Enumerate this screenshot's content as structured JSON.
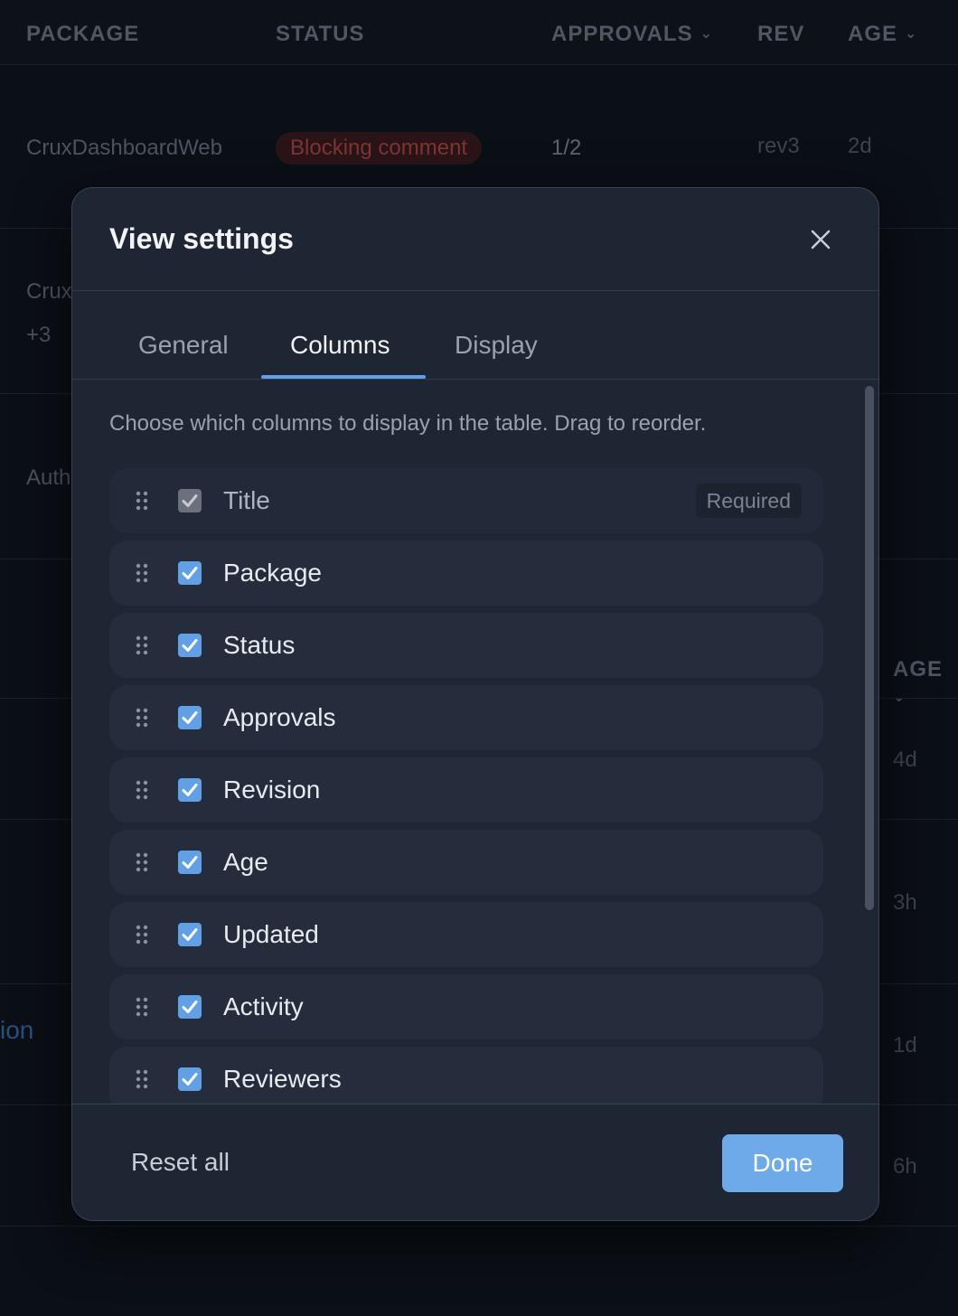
{
  "background_table": {
    "columns": {
      "package": "PACKAGE",
      "status": "STATUS",
      "approvals": "APPROVALS",
      "rev": "REV",
      "age": "AGE"
    },
    "rows": [
      {
        "package": "CruxDashboardWeb",
        "status": "Blocking comment",
        "approvals": "1/2",
        "rev": "rev3",
        "age": "2d"
      }
    ],
    "partial": {
      "crux": "Crux",
      "plus3": "+3",
      "auth": "Auth",
      "age_header": "AGE",
      "ion": "ion",
      "ages": [
        "4d",
        "3h",
        "1d",
        "6h"
      ]
    },
    "colors": {
      "status_blocking": "#7d3535",
      "link": "#2c4f7f"
    }
  },
  "modal": {
    "title": "View settings",
    "close_icon": "close-icon",
    "tabs": [
      {
        "label": "General",
        "active": false
      },
      {
        "label": "Columns",
        "active": true
      },
      {
        "label": "Display",
        "active": false
      }
    ],
    "intro": "Choose which columns to display in the table. Drag to reorder.",
    "columns": [
      {
        "label": "Title",
        "checked": true,
        "required": true,
        "required_label": "Required"
      },
      {
        "label": "Package",
        "checked": true
      },
      {
        "label": "Status",
        "checked": true
      },
      {
        "label": "Approvals",
        "checked": true
      },
      {
        "label": "Revision",
        "checked": true
      },
      {
        "label": "Age",
        "checked": true
      },
      {
        "label": "Updated",
        "checked": true
      },
      {
        "label": "Activity",
        "checked": true
      },
      {
        "label": "Reviewers",
        "checked": true
      }
    ],
    "footer": {
      "reset_label": "Reset all",
      "done_label": "Done"
    },
    "colors": {
      "accent": "#62a0e6",
      "done_button": "#6ea9ea"
    }
  }
}
